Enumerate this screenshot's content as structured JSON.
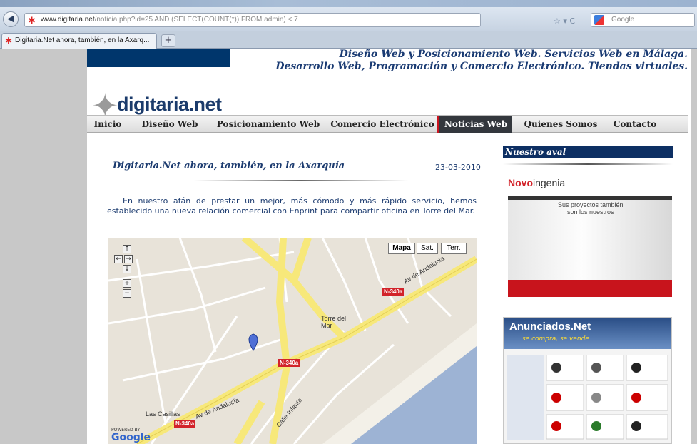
{
  "browser": {
    "url_domain": "www.digitaria.net",
    "url_path": "/noticia.php?id=25 AND (SELECT(COUNT(*)) FROM admin) < 7",
    "search_placeholder": "Google",
    "tab_title": "Digitaria.Net ahora, también, en la Axarq...",
    "new_tab": "+"
  },
  "header": {
    "tagline_1": "Diseño Web y Posicionamiento Web. Servicios Web en Málaga.",
    "tagline_2": "Desarrollo Web, Programación y Comercio Electrónico. Tiendas virtuales.",
    "logo": "digitaria.net"
  },
  "menu": [
    {
      "label": "Inicio",
      "active": false
    },
    {
      "label": "Diseño Web",
      "active": false
    },
    {
      "label": "Posicionamiento Web",
      "active": false
    },
    {
      "label": "Comercio Electrónico",
      "active": false
    },
    {
      "label": "Noticias Web",
      "active": true
    },
    {
      "label": "Quienes Somos",
      "active": false
    },
    {
      "label": "Contacto",
      "active": false
    }
  ],
  "article": {
    "title": "Digitaria.Net ahora, también, en la Axarquía",
    "date": "23-03-2010",
    "body": "En nuestro afán de prestar un mejor, más cómodo y más rápido servicio, hemos establecido una nueva relación comercial con Enprint para compartir oficina en Torre del Mar."
  },
  "map": {
    "types": [
      "Mapa",
      "Sat.",
      "Terr."
    ],
    "labels": {
      "town": "Torre del Mar",
      "las_casillas": "Las Casillas",
      "av_andalucia": "Av de Andalucía",
      "av_andalucia_2": "Av de Andalucía",
      "calle_infanta": "Calle Infanta"
    },
    "shields": [
      "N-340a",
      "N-340a",
      "N-340a"
    ],
    "powered_by": "POWERED BY",
    "powered_brand": "Google"
  },
  "sidebar": {
    "heading": "Nuestro aval",
    "novo_brand_a": "Novo",
    "novo_brand_b": "ingenia",
    "novo_slogan_1": "Sus proyectos también",
    "novo_slogan_2": "son los nuestros",
    "anun_title": "Anunciados.Net",
    "anun_sub": "se compra, se vende"
  },
  "colors": {
    "navy": "#00366c",
    "title_blue": "#1d3c70",
    "active_red": "#c9141f"
  }
}
